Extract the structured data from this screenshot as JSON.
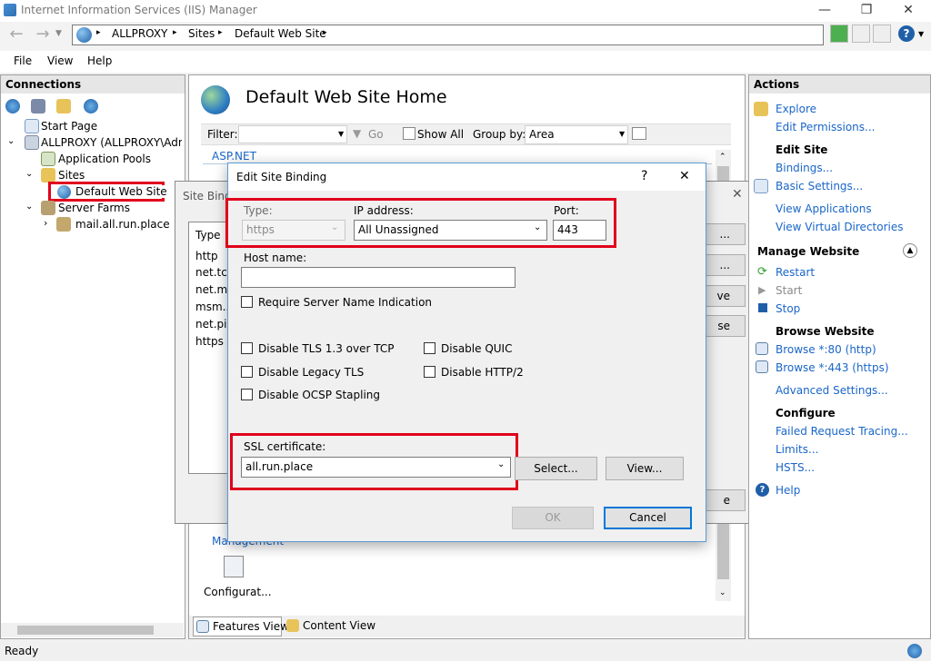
{
  "window": {
    "title": "Internet Information Services (IIS) Manager",
    "minimize": "—",
    "maximize": "❐",
    "close": "✕"
  },
  "address": {
    "crumbs": [
      "ALLPROXY",
      "Sites",
      "Default Web Site"
    ],
    "sep": "▸"
  },
  "menu": {
    "items": [
      "File",
      "View",
      "Help"
    ]
  },
  "connections": {
    "header": "Connections",
    "tree": {
      "start_page": "Start Page",
      "server": "ALLPROXY (ALLPROXY\\Admi",
      "app_pools": "Application Pools",
      "sites": "Sites",
      "default_site": "Default Web Site",
      "server_farms": "Server Farms",
      "farm_site": "mail.all.run.place"
    }
  },
  "center": {
    "page_title": "Default Web Site Home",
    "filter_label": "Filter:",
    "go_label": "Go",
    "show_all_label": "Show All",
    "group_by_label": "Group by:",
    "group_by_value": "Area",
    "section_aspnet": "ASP.NET",
    "section_management": "Management",
    "config_icon_label": "Configurat...",
    "features_view_tab": "Features View",
    "content_view_tab": "Content View"
  },
  "site_bindings": {
    "title_partial": "Site Bindi",
    "col_type": "Type",
    "types": [
      "http",
      "net.tcp",
      "net.m...",
      "msm...",
      "net.pi...",
      "https"
    ],
    "btn_add_partial": "...",
    "btn_edit_partial": "...",
    "btn_remove_partial": "ve",
    "btn_browse_partial": "se",
    "btn_close_partial": "e"
  },
  "edit_binding": {
    "title": "Edit Site Binding",
    "help": "?",
    "close": "✕",
    "type_label": "Type:",
    "type_value": "https",
    "ip_label": "IP address:",
    "ip_value": "All Unassigned",
    "port_label": "Port:",
    "port_value": "443",
    "host_label": "Host name:",
    "host_value": "",
    "sni_label": "Require Server Name Indication",
    "disable_tls13": "Disable TLS 1.3 over TCP",
    "disable_quic": "Disable QUIC",
    "disable_legacy_tls": "Disable Legacy TLS",
    "disable_http2": "Disable HTTP/2",
    "disable_ocsp": "Disable OCSP Stapling",
    "ssl_label": "SSL certificate:",
    "ssl_value": "all.run.place",
    "select_btn": "Select...",
    "view_btn": "View...",
    "ok_btn": "OK",
    "cancel_btn": "Cancel"
  },
  "actions": {
    "header": "Actions",
    "explore": "Explore",
    "edit_permissions": "Edit Permissions...",
    "edit_site_header": "Edit Site",
    "bindings": "Bindings...",
    "basic_settings": "Basic Settings...",
    "view_applications": "View Applications",
    "view_virtual_dirs": "View Virtual Directories",
    "manage_website_header": "Manage Website",
    "restart": "Restart",
    "start": "Start",
    "stop": "Stop",
    "browse_website_header": "Browse Website",
    "browse_80": "Browse *:80 (http)",
    "browse_443": "Browse *:443 (https)",
    "advanced_settings": "Advanced Settings...",
    "configure_header": "Configure",
    "failed_request_tracing": "Failed Request Tracing...",
    "limits": "Limits...",
    "hsts": "HSTS...",
    "help": "Help"
  },
  "status": {
    "text": "Ready"
  },
  "colors": {
    "highlight_red": "#e0001b",
    "link_blue": "#1a66c8",
    "dialog_border": "#5b9bd5"
  }
}
